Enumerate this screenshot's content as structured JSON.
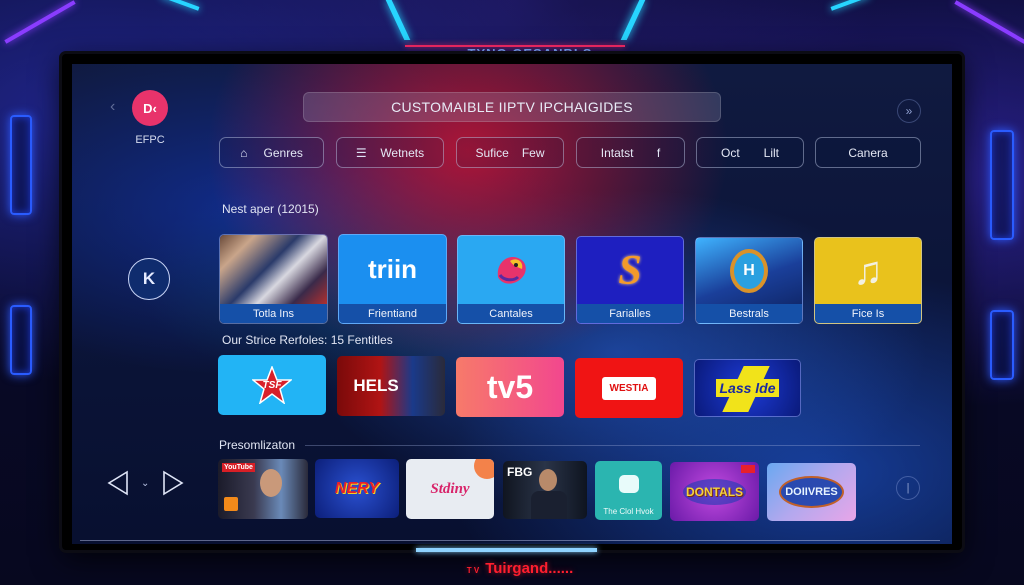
{
  "backdrop": {
    "top_title": "TYNG GESANBLS"
  },
  "header": {
    "back_icon": "chevron-left-icon",
    "logo_glyph": "D‹",
    "logo_label": "EFPC",
    "title": "CUSTOMAIBLE IIPTV IPCHAIGIDES",
    "forward_icon": "double-chevron-right-icon",
    "forward_glyph": "»"
  },
  "filters": [
    {
      "icon": "home-icon",
      "glyph": "⌂",
      "label": "Genres",
      "label2": ""
    },
    {
      "icon": "list-icon",
      "glyph": "☰",
      "label": "Wetnets",
      "label2": ""
    },
    {
      "icon": "",
      "glyph": "",
      "label": "Sufice",
      "label2": "Few"
    },
    {
      "icon": "",
      "glyph": "",
      "label": "Intatst",
      "label2": "f"
    },
    {
      "icon": "",
      "glyph": "",
      "label": "Oct",
      "label2": "Lilt"
    },
    {
      "icon": "",
      "glyph": "",
      "label": "Canera",
      "label2": ""
    }
  ],
  "section1": {
    "label": "Nest aper (12015)",
    "cards": [
      {
        "caption": "Totla Ins",
        "art_text": "",
        "art": "crowd-photo",
        "color": "#3a2a4a"
      },
      {
        "caption": "Frientiand",
        "art_text": "triin",
        "art": "wordmark",
        "color": "#1b8ff0"
      },
      {
        "caption": "Cantales",
        "art_text": "",
        "art": "bird-logo",
        "color": "#2aa8f2"
      },
      {
        "caption": "Farialles",
        "art_text": "S",
        "art": "s-logo",
        "color": "#1e1fc0"
      },
      {
        "caption": "Bestrals",
        "art_text": "H",
        "art": "badge-logo",
        "color": "#1a3f9a"
      },
      {
        "caption": "Fice Is",
        "art_text": "♫",
        "art": "music-note",
        "color": "#e9c21c"
      }
    ]
  },
  "section2": {
    "label": "Our Strice Rerfoles: 15 Fentitles",
    "tiles": [
      {
        "text": "TSF",
        "art": "star-logo",
        "color": "#22b4f5"
      },
      {
        "text": "HELS",
        "art": "poster",
        "color": "#8a1010"
      },
      {
        "text": "tv5",
        "art": "wordmark",
        "color": "#f35c86"
      },
      {
        "text": "WESTIA",
        "art": "wordmark",
        "color": "#f01414"
      },
      {
        "text": "Lass lde",
        "art": "bolt-logo",
        "color": "#0a1a9a"
      }
    ]
  },
  "k_button": "K",
  "section3": {
    "label": "Presomlizaton",
    "tiles": [
      {
        "text": "YouTube",
        "art": "poster-men",
        "color": "#1b1b2a",
        "caption": ""
      },
      {
        "text": "NERY",
        "art": "logo",
        "color": "#1430a0",
        "caption": ""
      },
      {
        "text": "Stdiny",
        "art": "script-logo",
        "color": "#e8ecf2",
        "caption": ""
      },
      {
        "text": "FBG",
        "art": "poster-man",
        "color": "#101520",
        "caption": ""
      },
      {
        "text": "",
        "art": "chat-logo",
        "color": "#2bb5b0",
        "caption": "The Clol Hvok"
      },
      {
        "text": "DONTALS",
        "art": "game-logo",
        "color": "#8a2ad0",
        "caption": ""
      },
      {
        "text": "DOIIVRES",
        "art": "game-logo",
        "color": "#8fb3ee",
        "caption": ""
      }
    ]
  },
  "nav": {
    "prev_icon": "triangle-left-icon",
    "mid_glyph": "⌄",
    "next_icon": "triangle-right-icon",
    "info_glyph": "|"
  },
  "playback": {
    "progress": 0.42
  },
  "footer": {
    "small": "T V",
    "brand": "Tuirgand......"
  }
}
